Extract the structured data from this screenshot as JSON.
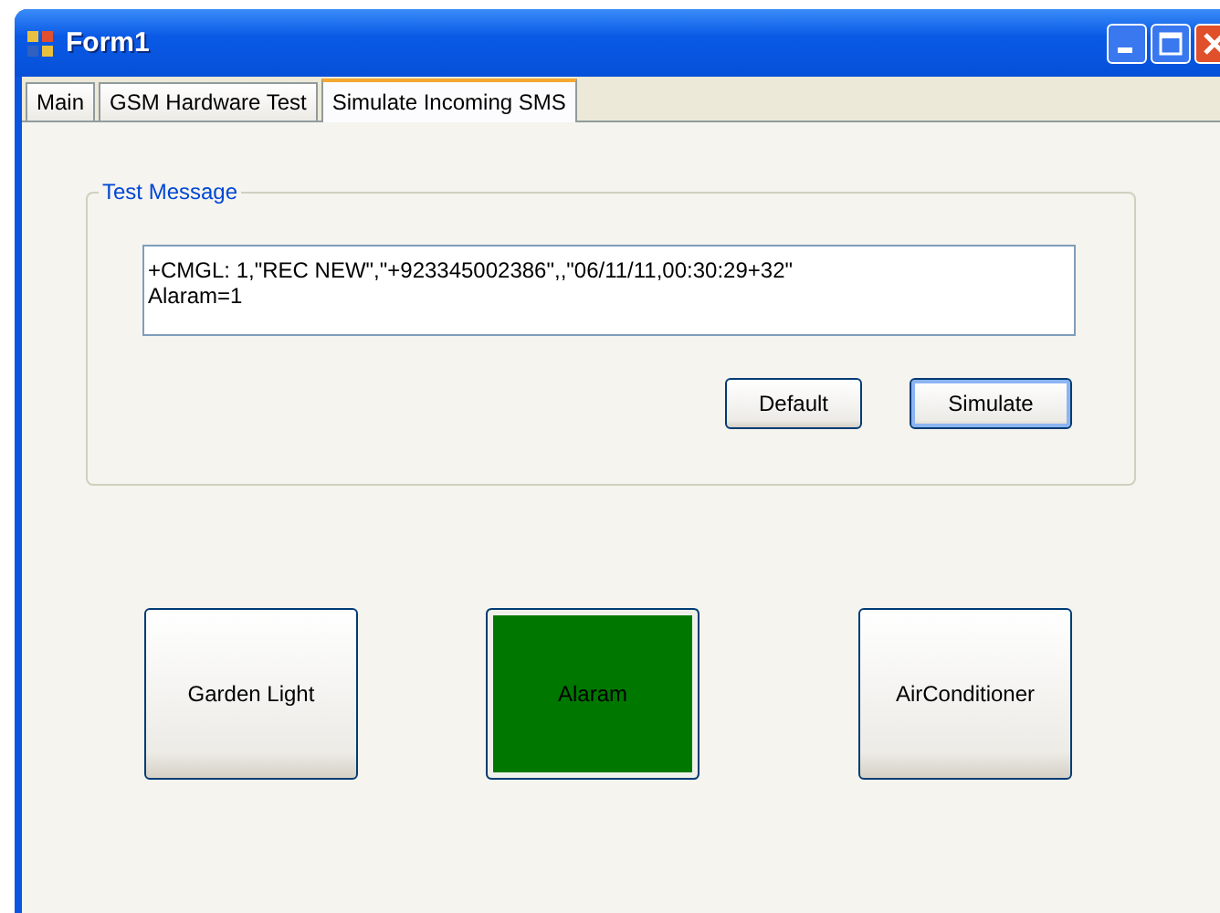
{
  "window": {
    "title": "Form1"
  },
  "tabs": [
    {
      "label": "Main",
      "selected": false
    },
    {
      "label": "GSM Hardware Test",
      "selected": false
    },
    {
      "label": "Simulate Incoming SMS",
      "selected": true
    }
  ],
  "test_message": {
    "title": "Test Message",
    "value": "+CMGL: 1,\"REC NEW\",\"+923345002386\",,\"06/11/11,00:30:29+32\"\nAlaram=1",
    "buttons": [
      "Default",
      "Simulate"
    ]
  },
  "devices": [
    {
      "label": "Garden Light",
      "on": false
    },
    {
      "label": "Alaram",
      "on": true
    },
    {
      "label": "AirConditioner",
      "on": false
    }
  ]
}
